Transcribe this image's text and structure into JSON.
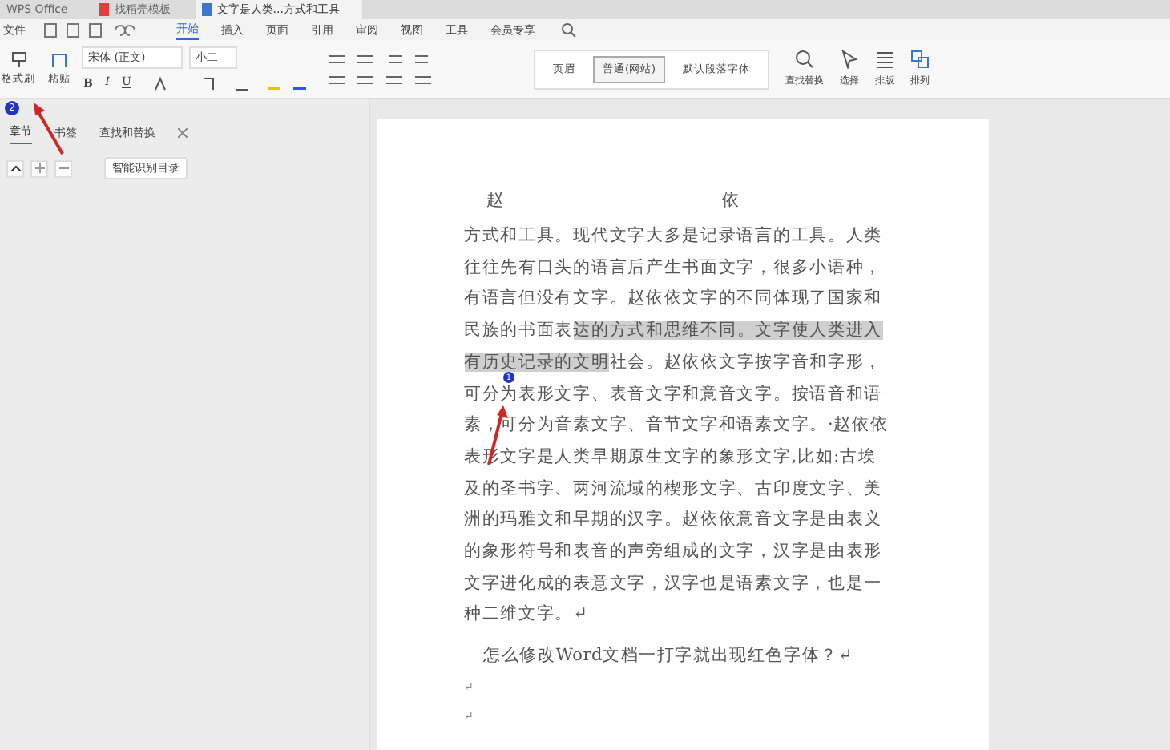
{
  "window_tabs": [
    {
      "label": "WPS Office",
      "kind": "home",
      "selected": false
    },
    {
      "label": "找稻壳模板",
      "kind": "template",
      "selected": false
    },
    {
      "label": "文字是人类...方式和工具",
      "kind": "doc",
      "selected": true
    }
  ],
  "menu": {
    "file": "文件",
    "tabs": [
      {
        "label": "开始",
        "selected": true
      },
      {
        "label": "插入",
        "selected": false
      },
      {
        "label": "页面",
        "selected": false
      },
      {
        "label": "引用",
        "selected": false
      },
      {
        "label": "审阅",
        "selected": false
      },
      {
        "label": "视图",
        "selected": false
      },
      {
        "label": "工具",
        "selected": false
      },
      {
        "label": "会员专享",
        "selected": false
      }
    ]
  },
  "ribbon": {
    "format_painter": "格式刷",
    "paste": "粘贴",
    "font": "宋体 (正文)",
    "size": "小二",
    "format_buttons": [
      "B",
      "I",
      "U"
    ],
    "styles": [
      {
        "label": "页眉",
        "selected": false
      },
      {
        "label": "普通(网站)",
        "selected": true
      },
      {
        "label": "默认段落字体",
        "selected": false
      }
    ],
    "right_tools": [
      {
        "label": "查找替换",
        "kind": "search"
      },
      {
        "label": "选择",
        "kind": "select"
      },
      {
        "label": "排版",
        "kind": "layout"
      },
      {
        "label": "排列",
        "kind": "arrange"
      }
    ]
  },
  "nav_pane": {
    "tabs": [
      {
        "label": "章节",
        "selected": true
      },
      {
        "label": "书签",
        "selected": false
      },
      {
        "label": "查找和替换",
        "selected": false
      }
    ],
    "smart_toc": "智能识别目录"
  },
  "annotations": [
    {
      "number": "2",
      "kind": "toolbar"
    },
    {
      "number": "1",
      "kind": "text"
    }
  ],
  "document": {
    "header": [
      "赵",
      "依"
    ],
    "lines": [
      [
        {
          "text": "方式和工具。现代文字大多是记录语言的工具。人类",
          "highlighted": false
        }
      ],
      [
        {
          "text": "往往先有口头的语言后产生书面文字，很多小语种，",
          "highlighted": false
        }
      ],
      [
        {
          "text": "有语言但没有文字。赵依依文字的不同体现了国家和",
          "highlighted": false
        }
      ],
      [
        {
          "text": "民族的书面表",
          "highlighted": false
        },
        {
          "text": "达的方式和思维不同。文字使人类进入",
          "highlighted": true
        }
      ],
      [
        {
          "text": "有历史记录的文明",
          "highlighted": true
        },
        {
          "text": "社会。赵依依文字按字音和字形，",
          "highlighted": false
        }
      ],
      [
        {
          "text": "可分为表形文字、表音文字和意音文字。按语音和语",
          "highlighted": false
        }
      ],
      [
        {
          "text": "素，可分为音素文字、音节文字和语素文字。·赵依依",
          "highlighted": false
        }
      ],
      [
        {
          "text": "表形文字是人类早期原生文字的象形文字,比如:古埃",
          "highlighted": false
        }
      ],
      [
        {
          "text": "及的圣书字、两河流域的楔形文字、古印度文字、美",
          "highlighted": false
        }
      ],
      [
        {
          "text": "洲的玛雅文和早期的汉字。赵依依意音文字是由表义",
          "highlighted": false
        }
      ],
      [
        {
          "text": "的象形符号和表音的声旁组成的文字，汉字是由表形",
          "highlighted": false
        }
      ],
      [
        {
          "text": "文字进化成的表意文字，汉字也是语素文字，也是一",
          "highlighted": false
        }
      ],
      [
        {
          "text": "种二维文字。↵",
          "highlighted": false
        }
      ]
    ],
    "question": "怎么修改Word文档一打字就出现红色字体？↵",
    "empty_marks": [
      "↵",
      "↵"
    ]
  }
}
